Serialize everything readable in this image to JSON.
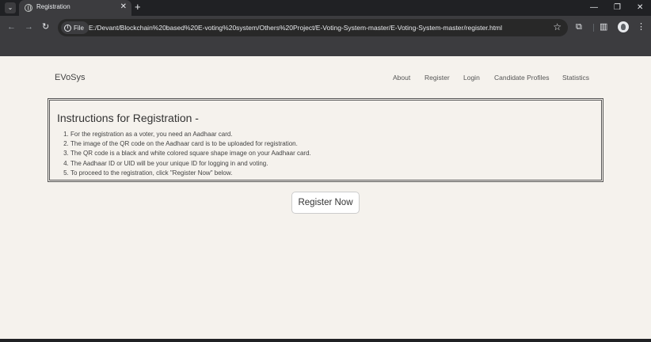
{
  "browser": {
    "tab_title": "Registration",
    "tab_close": "✕",
    "new_tab": "+",
    "site_chip_label": "File",
    "url": "E:/Devant/Blockchain%20based%20E-voting%20system/Others%20Project/E-Voting-System-master/E-Voting-System-master/register.html"
  },
  "site": {
    "brand": "EVoSys",
    "nav": [
      "About",
      "Register",
      "Login",
      "Candidate Profiles",
      "Statistics"
    ]
  },
  "instructions": {
    "title": "Instructions for Registration -",
    "items": [
      "For the registration as a voter, you need an Aadhaar card.",
      "The image of the QR code on the Aadhaar card is to be uploaded for registration.",
      "The QR code is a black and white colored square shape image on your Aadhaar card.",
      "The Aadhaar ID or UID will be your unique ID for logging in and voting.",
      "To proceed to the registration, click \"Register Now\" below."
    ]
  },
  "register_button": "Register Now"
}
